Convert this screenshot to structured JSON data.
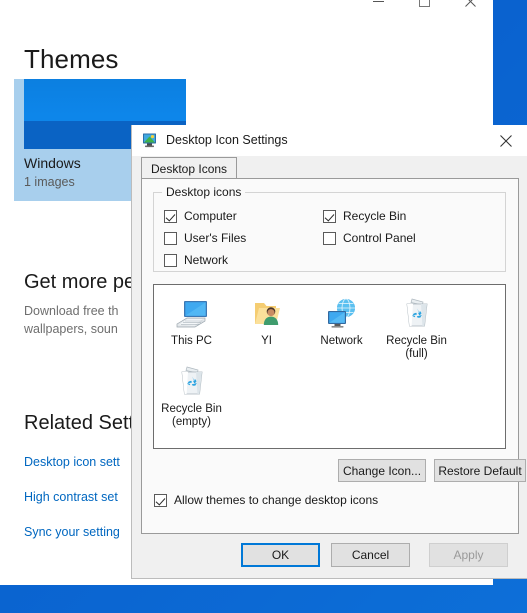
{
  "desktop": {
    "background_color": "#0a62cf"
  },
  "settings_window": {
    "title_controls": {
      "minimize": "minimize-icon",
      "maximize": "maximize-icon",
      "close": "close-icon"
    },
    "page_title": "Themes",
    "theme_tile": {
      "name": "Windows",
      "count": "1 images",
      "selected": true,
      "accent_color": "#a8cfed"
    },
    "get_more_section": {
      "title": "Get more pe",
      "line1": "Download free th",
      "line2": "wallpapers, soun"
    },
    "related_section": {
      "title": "Related Sett",
      "links": [
        "Desktop icon sett",
        "High contrast set",
        "Sync your setting"
      ],
      "link_color": "#0067c0"
    }
  },
  "dialog": {
    "title": "Desktop Icon Settings",
    "icon": "desktop-icon-settings-icon",
    "close_label": "close-icon",
    "tabs": [
      {
        "label": "Desktop Icons",
        "active": true
      }
    ],
    "groupbox": {
      "legend": "Desktop icons",
      "checkboxes": [
        {
          "label": "Computer",
          "checked": true
        },
        {
          "label": "User's Files",
          "checked": false
        },
        {
          "label": "Network",
          "checked": false
        },
        {
          "label": "Recycle Bin",
          "checked": true
        },
        {
          "label": "Control Panel",
          "checked": false
        }
      ]
    },
    "icon_preview": [
      {
        "label": "This PC",
        "icon": "this-pc-icon"
      },
      {
        "label": "YI",
        "icon": "user-folder-icon"
      },
      {
        "label": "Network",
        "icon": "network-icon"
      },
      {
        "label": "Recycle Bin\n(full)",
        "icon": "recycle-bin-full-icon"
      },
      {
        "label": "Recycle Bin\n(empty)",
        "icon": "recycle-bin-empty-icon"
      }
    ],
    "buttons": {
      "change_icon": "Change Icon...",
      "restore_default": "Restore Default"
    },
    "allow_themes": {
      "label": "Allow themes to change desktop icons",
      "checked": true
    },
    "footer": {
      "ok": "OK",
      "cancel": "Cancel",
      "apply": "Apply",
      "ok_focused": true,
      "apply_disabled": true,
      "focus_color": "#0078d7"
    }
  }
}
